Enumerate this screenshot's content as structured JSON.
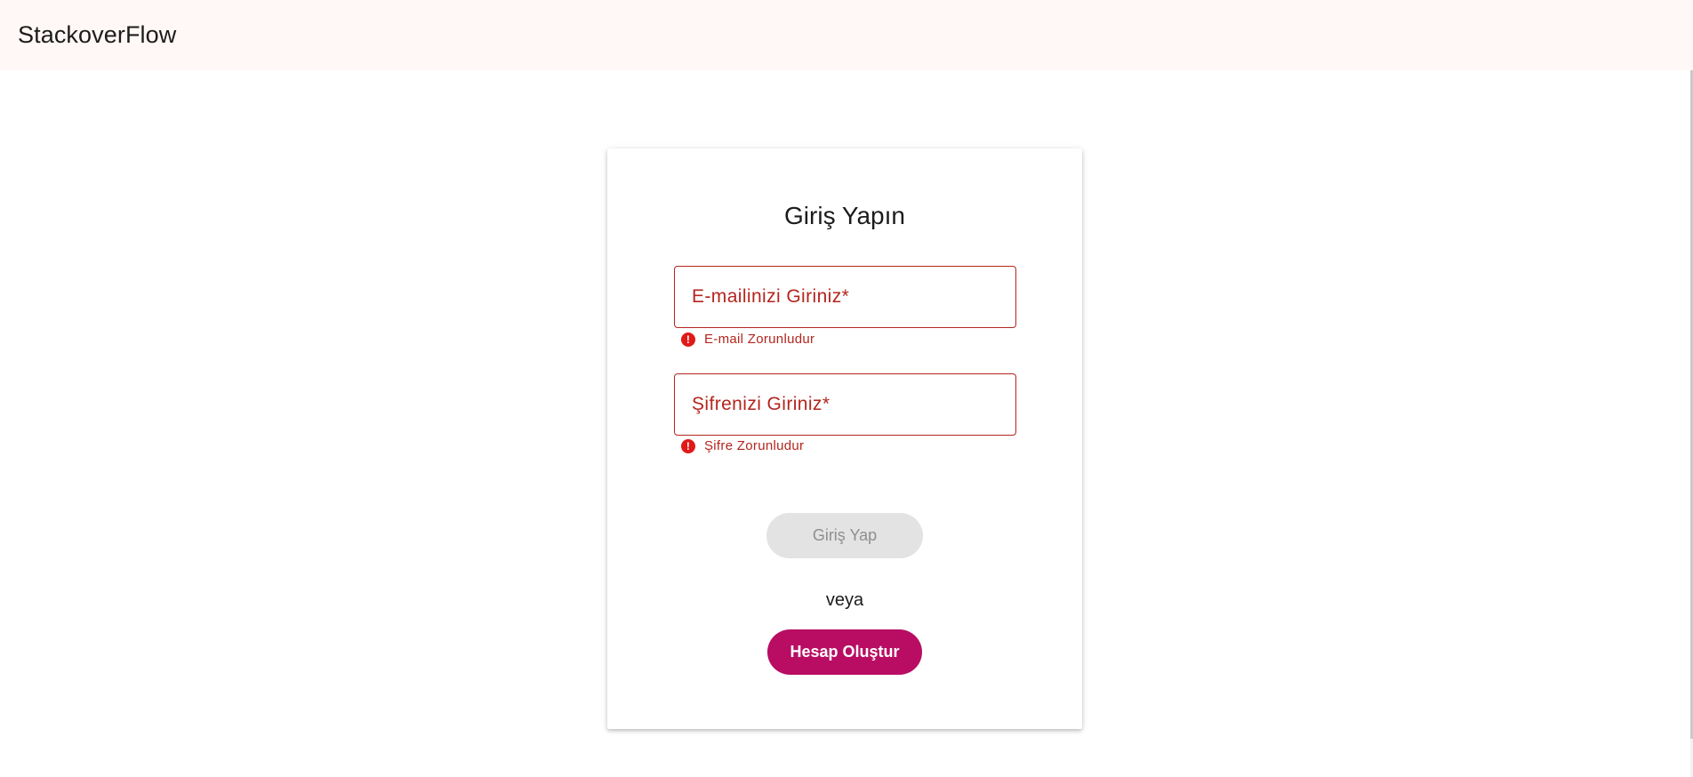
{
  "header": {
    "brand": "StackoverFlow"
  },
  "login_card": {
    "title": "Giriş Yapın",
    "email": {
      "placeholder": "E-mailinizi Giriniz*",
      "error": "E-mail Zorunludur"
    },
    "password": {
      "placeholder": "Şifrenizi Giriniz*",
      "error": "Şifre Zorunludur"
    },
    "login_button": "Giriş Yap",
    "or_text": "veya",
    "signup_button": "Hesap Oluştur",
    "error_icon_glyph": "!"
  },
  "colors": {
    "toolbar_bg": "#fff8f7",
    "error": "#b3261e",
    "error_icon": "#e01919",
    "primary": "#b80d62",
    "disabled_bg": "#e3e3e3",
    "disabled_text": "#8f8f8f"
  },
  "icons": {
    "error_icon": "error-circle-icon"
  }
}
